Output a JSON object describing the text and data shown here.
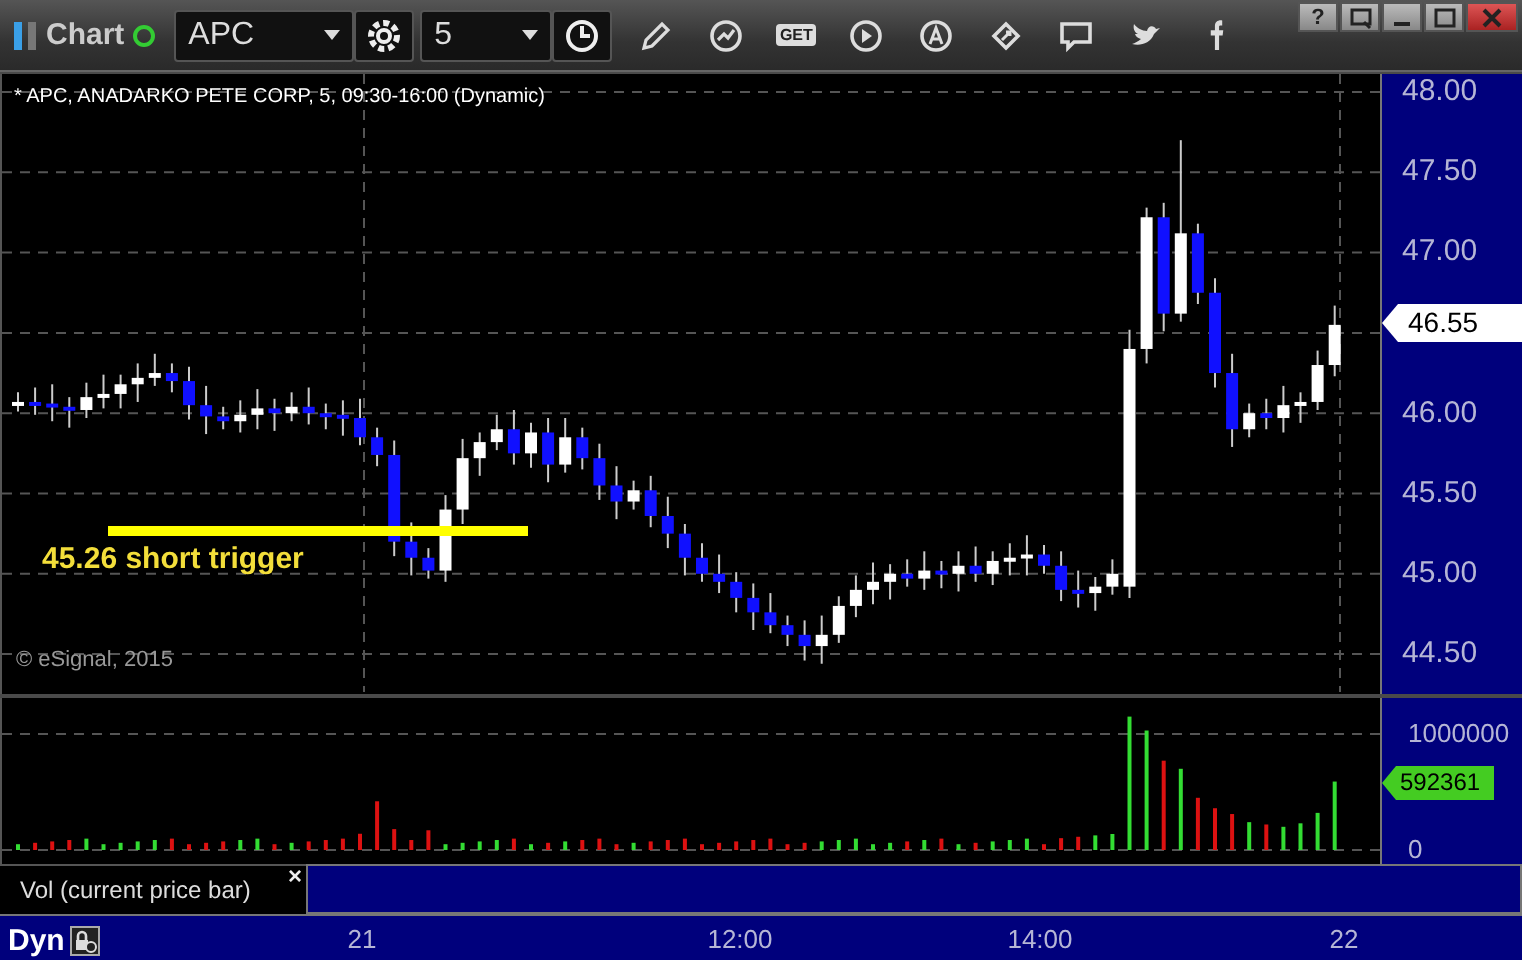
{
  "window": {
    "title": "Chart",
    "help_button": "?"
  },
  "toolbar": {
    "symbol": "APC",
    "interval": "5",
    "get_label": "GET"
  },
  "chart": {
    "title": "* APC, ANADARKO PETE CORP, 5, 09:30-16:00 (Dynamic)",
    "annotation": "45.26 short trigger",
    "copyright": "© eSignal, 2015",
    "price_axis": [
      "48.00",
      "47.50",
      "47.00",
      "46.00",
      "45.50",
      "45.00",
      "44.50"
    ],
    "last_price": "46.55"
  },
  "volume": {
    "axis": [
      "1000000",
      "0"
    ],
    "last_volume": "592361",
    "legend": "Vol (current price bar)",
    "close_symbol": "×"
  },
  "time_axis": {
    "mode": "Dyn",
    "labels": [
      "21",
      "12:00",
      "14:00",
      "22"
    ]
  }
}
